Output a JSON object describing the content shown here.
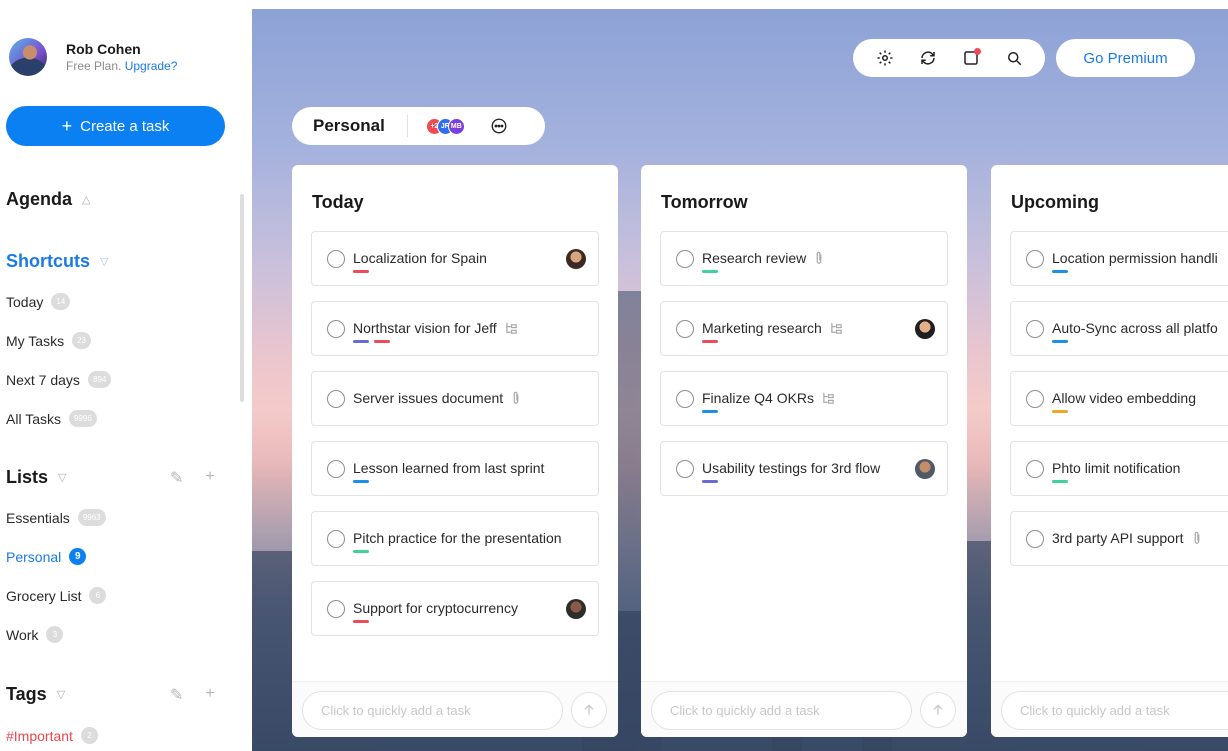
{
  "profile": {
    "name": "Rob Cohen",
    "plan": "Free Plan.",
    "upgrade": "Upgrade?"
  },
  "create_button": {
    "icon": "+",
    "label": "Create a task"
  },
  "sections": {
    "agenda": "Agenda",
    "shortcuts": "Shortcuts",
    "lists": "Lists",
    "tags": "Tags"
  },
  "shortcuts": [
    {
      "label": "Today",
      "count": "14"
    },
    {
      "label": "My Tasks",
      "count": "23"
    },
    {
      "label": "Next 7 days",
      "count": "894"
    },
    {
      "label": "All Tasks",
      "count": "9996"
    }
  ],
  "lists": [
    {
      "label": "Essentials",
      "count": "9963"
    },
    {
      "label": "Personal",
      "count": "9"
    },
    {
      "label": "Grocery List",
      "count": "6"
    },
    {
      "label": "Work",
      "count": "3"
    }
  ],
  "tags": [
    {
      "label": "#Important",
      "count": "2"
    }
  ],
  "toolbar": {
    "premium_label": "Go Premium"
  },
  "board": {
    "list_title": "Personal",
    "members": [
      {
        "initials": "+2",
        "color": "#ef4a52"
      },
      {
        "initials": "JR",
        "color": "#2b6ef0"
      },
      {
        "initials": "MB",
        "color": "#7a3fe0"
      }
    ]
  },
  "colors": {
    "accent": "#0b80f3",
    "tag_red": "#ef4a5a",
    "tag_blue": "#1a90e8",
    "tag_green": "#3ed39a",
    "tag_purple": "#6a6ad6",
    "tag_orange": "#f5a524"
  },
  "columns": [
    {
      "title": "Today",
      "placeholder": "Click to quickly add a task",
      "tasks": [
        {
          "text": "Localization for Spain",
          "tags": [
            "red"
          ],
          "icon": "",
          "avatar": "a1"
        },
        {
          "text": "Northstar vision for Jeff",
          "tags": [
            "purple",
            "red"
          ],
          "icon": "subtask-icon",
          "avatar": ""
        },
        {
          "text": "Server issues document",
          "tags": [],
          "icon": "attachment-icon",
          "avatar": ""
        },
        {
          "text": "Lesson learned from last sprint",
          "tags": [
            "blue"
          ],
          "icon": "",
          "avatar": ""
        },
        {
          "text": "Pitch practice for the presentation",
          "tags": [
            "green"
          ],
          "icon": "",
          "avatar": ""
        },
        {
          "text": "Support for cryptocurrency",
          "tags": [
            "red"
          ],
          "icon": "",
          "avatar": "a2"
        }
      ]
    },
    {
      "title": "Tomorrow",
      "placeholder": "Click to quickly add a task",
      "tasks": [
        {
          "text": "Research review",
          "tags": [
            "green"
          ],
          "icon": "attachment-icon",
          "avatar": ""
        },
        {
          "text": "Marketing research",
          "tags": [
            "red"
          ],
          "icon": "subtask-icon",
          "avatar": "a3"
        },
        {
          "text": "Finalize Q4 OKRs",
          "tags": [
            "blue"
          ],
          "icon": "subtask-icon",
          "avatar": ""
        },
        {
          "text": "Usability testings for 3rd flow",
          "tags": [
            "purple"
          ],
          "icon": "",
          "avatar": "a4"
        }
      ]
    },
    {
      "title": "Upcoming",
      "placeholder": "Click to quickly add a task",
      "tasks": [
        {
          "text": "Location permission handli",
          "tags": [
            "blue"
          ],
          "icon": "",
          "avatar": ""
        },
        {
          "text": "Auto-Sync across all platfo",
          "tags": [
            "blue"
          ],
          "icon": "",
          "avatar": ""
        },
        {
          "text": "Allow video embedding",
          "tags": [
            "orange"
          ],
          "icon": "",
          "avatar": ""
        },
        {
          "text": "Phto limit notification",
          "tags": [
            "green"
          ],
          "icon": "",
          "avatar": ""
        },
        {
          "text": "3rd party API support",
          "tags": [],
          "icon": "attachment-icon",
          "avatar": ""
        }
      ]
    }
  ]
}
